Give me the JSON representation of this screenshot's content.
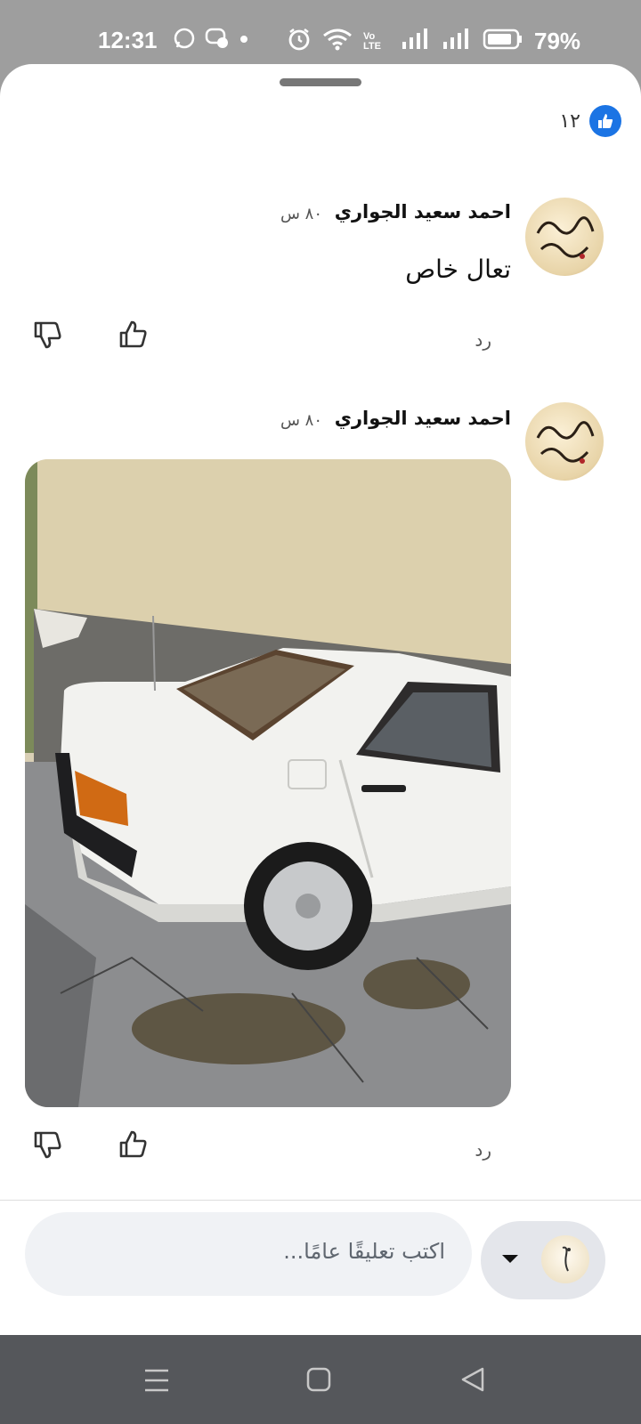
{
  "status_bar": {
    "time": "12:31",
    "network_label": "Vo LTE",
    "battery": "79%"
  },
  "reactions": {
    "like_count": "١٢"
  },
  "comments": [
    {
      "author": "احمد سعيد الجواري",
      "time": "٨٠ س",
      "text": "تعال خاص",
      "reply_label": "رد"
    },
    {
      "author": "احمد سعيد الجواري",
      "time": "٨٠ س",
      "attachment": "photo",
      "reply_label": "رد"
    }
  ],
  "composer": {
    "placeholder": "اكتب تعليقًا عامًا..."
  },
  "colors": {
    "like_blue": "#1b74e4",
    "status_bar_bg": "#9e9e9e",
    "nav_bar_bg": "#55575b",
    "input_bg": "#f0f2f5"
  },
  "icons": [
    "whatsapp-icon",
    "messenger-icon",
    "alarm-icon",
    "wifi-icon",
    "signal-icon",
    "battery-icon",
    "like-icon",
    "dislike-icon",
    "chevron-down-icon",
    "menu-icon",
    "home-icon",
    "back-icon"
  ]
}
